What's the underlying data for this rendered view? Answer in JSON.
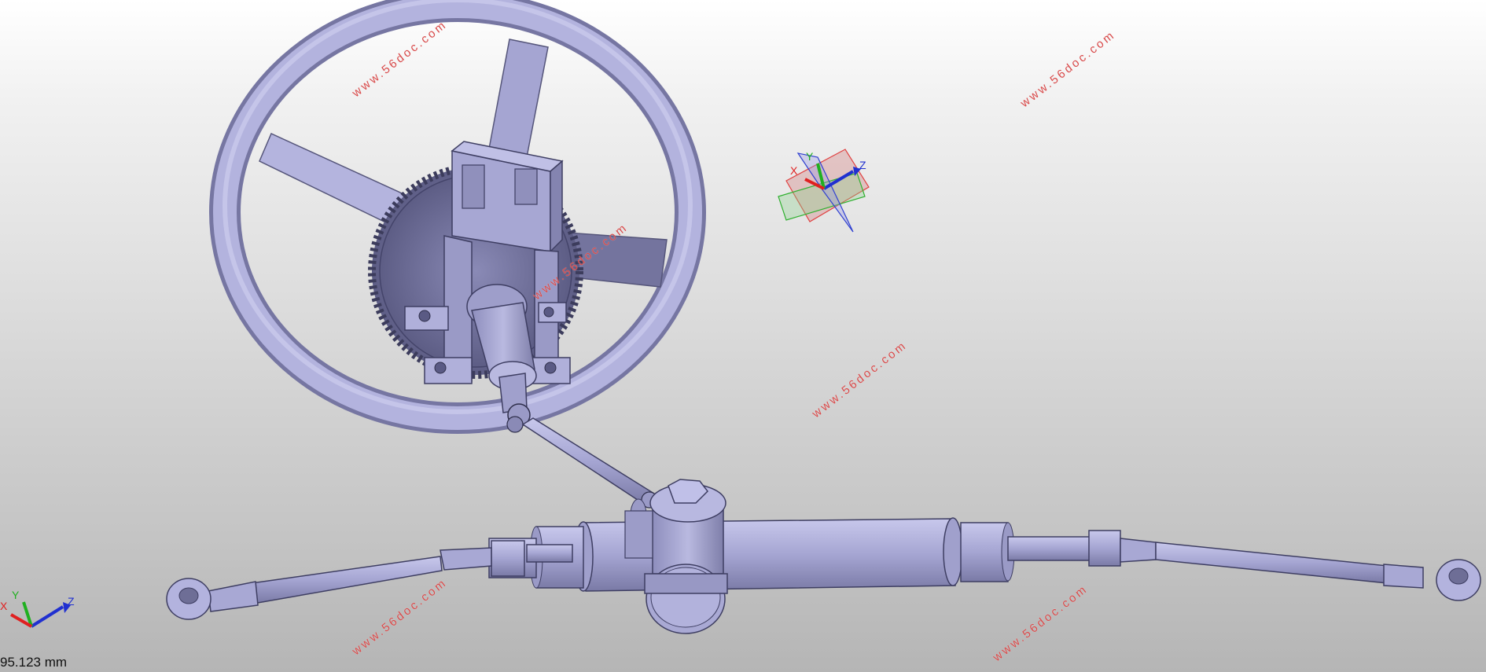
{
  "viewport": {
    "background_top": "#ffffff",
    "background_bottom": "#b5b5b5",
    "part_color": "#a9a9d6",
    "part_shadow": "#6e6e96"
  },
  "watermarks": [
    "www.56doc.com",
    "www.56doc.com",
    "www.56doc.com",
    "www.56doc.com",
    "www.56doc.com",
    "www.56doc.com"
  ],
  "triad_center": {
    "x_label": "X",
    "y_label": "Y",
    "z_label": "Z",
    "x_color": "#e02020",
    "y_color": "#20b020",
    "z_color": "#2030d0"
  },
  "triad_corner": {
    "x_label": "X",
    "y_label": "Y",
    "z_label": "Z"
  },
  "status": {
    "scale_text": "95.123 mm"
  },
  "model": {
    "icon": "steering-assembly-icon"
  }
}
